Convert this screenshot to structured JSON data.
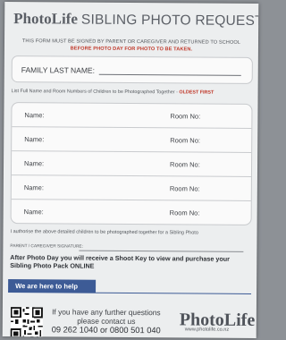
{
  "header": {
    "brand": "PhotoLife",
    "title": "SIBLING PHOTO REQUEST"
  },
  "instructions": {
    "line1": "THIS FORM MUST BE SIGNED BY PARENT OR CAREGIVER AND RETURNED TO SCHOOL",
    "line2": "BEFORE PHOTO DAY FOR PHOTO TO BE TAKEN."
  },
  "family": {
    "label": "FAMILY LAST NAME:"
  },
  "list_instruction": {
    "text": "List Full Name and Room Numbers of Children to be Photographed Together - ",
    "emphasis": "OLDEST FIRST"
  },
  "child_rows": [
    {
      "name_label": "Name:",
      "room_label": "Room No:"
    },
    {
      "name_label": "Name:",
      "room_label": "Room No:"
    },
    {
      "name_label": "Name:",
      "room_label": "Room No:"
    },
    {
      "name_label": "Name:",
      "room_label": "Room No:"
    },
    {
      "name_label": "Name:",
      "room_label": "Room No:"
    }
  ],
  "authorise_text": "I authorise the above detailed children to be photographed together for a Sibling Photo",
  "signature_label": "PARENT / CAREGIVER SIGNATURE:",
  "shoot_key_text": "After Photo Day you will receive a Shoot Key to view and purchase your Sibling Photo Pack ONLINE",
  "help": {
    "banner": "We are here to help",
    "line1": "If you have any further questions",
    "line2": "please contact us",
    "phone": "09 262 1040 or 0800 501 040"
  },
  "footer": {
    "brand": "PhotoLife",
    "url": "www.photolife.co.nz"
  },
  "colors": {
    "accent_red": "#c0392b",
    "help_blue": "#3d5b96"
  }
}
